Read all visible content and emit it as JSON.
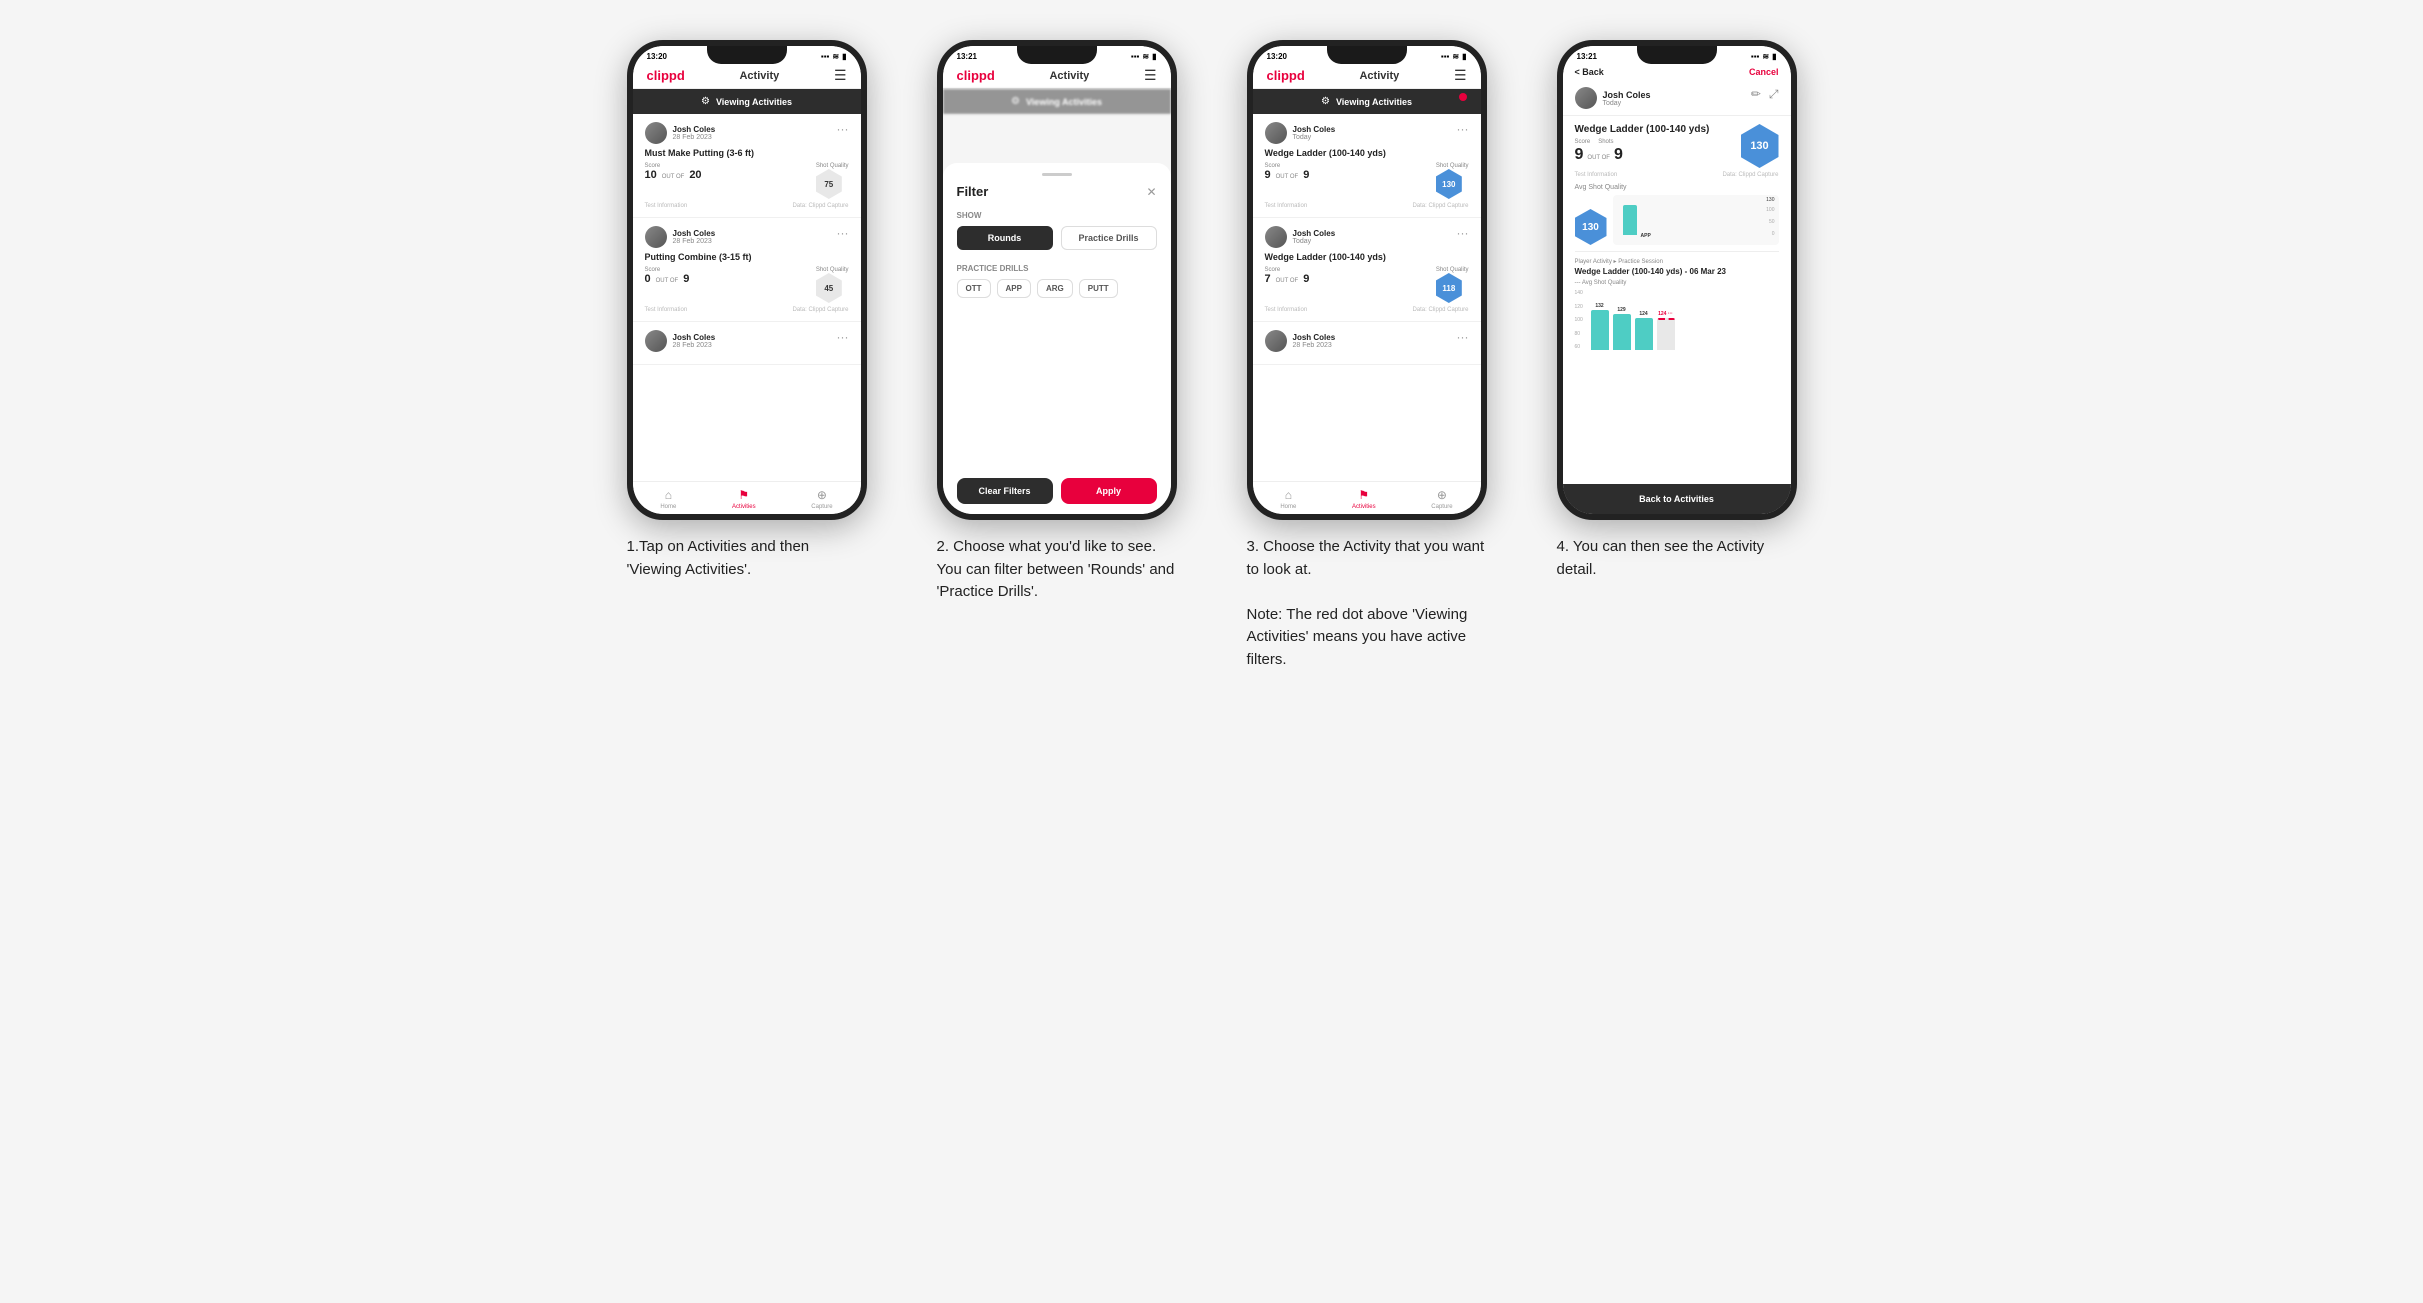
{
  "phones": [
    {
      "id": "phone1",
      "status_time": "13:20",
      "app_name": "clippd",
      "app_section": "Activity",
      "viewing_banner": "Viewing Activities",
      "has_red_dot": false,
      "cards": [
        {
          "user_name": "Josh Coles",
          "user_date": "28 Feb 2023",
          "title": "Must Make Putting (3-6 ft)",
          "score_label": "Score",
          "shots_label": "Shots",
          "shot_quality_label": "Shot Quality",
          "score": "10",
          "out_of": "OUT OF",
          "shots": "20",
          "shot_quality": "75",
          "test_info": "Test Information",
          "data_source": "Data: Clippd Capture"
        },
        {
          "user_name": "Josh Coles",
          "user_date": "28 Feb 2023",
          "title": "Putting Combine (3-15 ft)",
          "score_label": "Score",
          "shots_label": "Shots",
          "shot_quality_label": "Shot Quality",
          "score": "0",
          "out_of": "OUT OF",
          "shots": "9",
          "shot_quality": "45",
          "test_info": "Test Information",
          "data_source": "Data: Clippd Capture"
        },
        {
          "user_name": "Josh Coles",
          "user_date": "28 Feb 2023",
          "title": "",
          "score": "",
          "shots": "",
          "shot_quality": ""
        }
      ],
      "bottom_nav": [
        "Home",
        "Activities",
        "Capture"
      ]
    },
    {
      "id": "phone2",
      "status_time": "13:21",
      "app_name": "clippd",
      "app_section": "Activity",
      "viewing_banner": "Viewing Activities",
      "has_red_dot": false,
      "filter": {
        "title": "Filter",
        "show_label": "Show",
        "rounds_label": "Rounds",
        "practice_drills_label": "Practice Drills",
        "practice_drills_section": "Practice Drills",
        "tags": [
          "OTT",
          "APP",
          "ARG",
          "PUTT"
        ],
        "clear_label": "Clear Filters",
        "apply_label": "Apply"
      }
    },
    {
      "id": "phone3",
      "status_time": "13:20",
      "app_name": "clippd",
      "app_section": "Activity",
      "viewing_banner": "Viewing Activities",
      "has_red_dot": true,
      "cards": [
        {
          "user_name": "Josh Coles",
          "user_date": "Today",
          "title": "Wedge Ladder (100-140 yds)",
          "score_label": "Score",
          "shots_label": "Shots",
          "shot_quality_label": "Shot Quality",
          "score": "9",
          "out_of": "OUT OF",
          "shots": "9",
          "shot_quality": "130",
          "shot_quality_blue": true,
          "test_info": "Test Information",
          "data_source": "Data: Clippd Capture"
        },
        {
          "user_name": "Josh Coles",
          "user_date": "Today",
          "title": "Wedge Ladder (100-140 yds)",
          "score_label": "Score",
          "shots_label": "Shots",
          "shot_quality_label": "Shot Quality",
          "score": "7",
          "out_of": "OUT OF",
          "shots": "9",
          "shot_quality": "118",
          "shot_quality_blue": true,
          "test_info": "Test Information",
          "data_source": "Data: Clippd Capture"
        },
        {
          "user_name": "Josh Coles",
          "user_date": "28 Feb 2023",
          "title": "",
          "score": "",
          "shots": "",
          "shot_quality": ""
        }
      ],
      "bottom_nav": [
        "Home",
        "Activities",
        "Capture"
      ]
    },
    {
      "id": "phone4",
      "status_time": "13:21",
      "back_label": "< Back",
      "cancel_label": "Cancel",
      "user_name": "Josh Coles",
      "user_date": "Today",
      "detail_title": "Wedge Ladder (100-140 yds)",
      "score_label": "Score",
      "shots_label": "Shots",
      "score_value": "9",
      "out_of_label": "OUT OF",
      "shots_value": "9",
      "avg_shot_quality_label": "Avg Shot Quality",
      "avg_shot_quality_value": "130",
      "test_info": "Test Information",
      "data_source": "Data: Clippd Capture",
      "session_type_label": "Player Activity",
      "session_type": "Practice Session",
      "session_title": "Wedge Ladder (100-140 yds) - 06 Mar 23",
      "session_avg_label": "--- Avg Shot Quality",
      "chart_values": [
        132,
        129,
        124
      ],
      "chart_target": 124,
      "back_to_activities_label": "Back to Activities"
    }
  ],
  "captions": [
    "1.Tap on Activities and then 'Viewing Activities'.",
    "2. Choose what you'd like to see. You can filter between 'Rounds' and 'Practice Drills'.",
    "3. Choose the Activity that you want to look at.\n\nNote: The red dot above 'Viewing Activities' means you have active filters.",
    "4. You can then see the Activity detail."
  ]
}
